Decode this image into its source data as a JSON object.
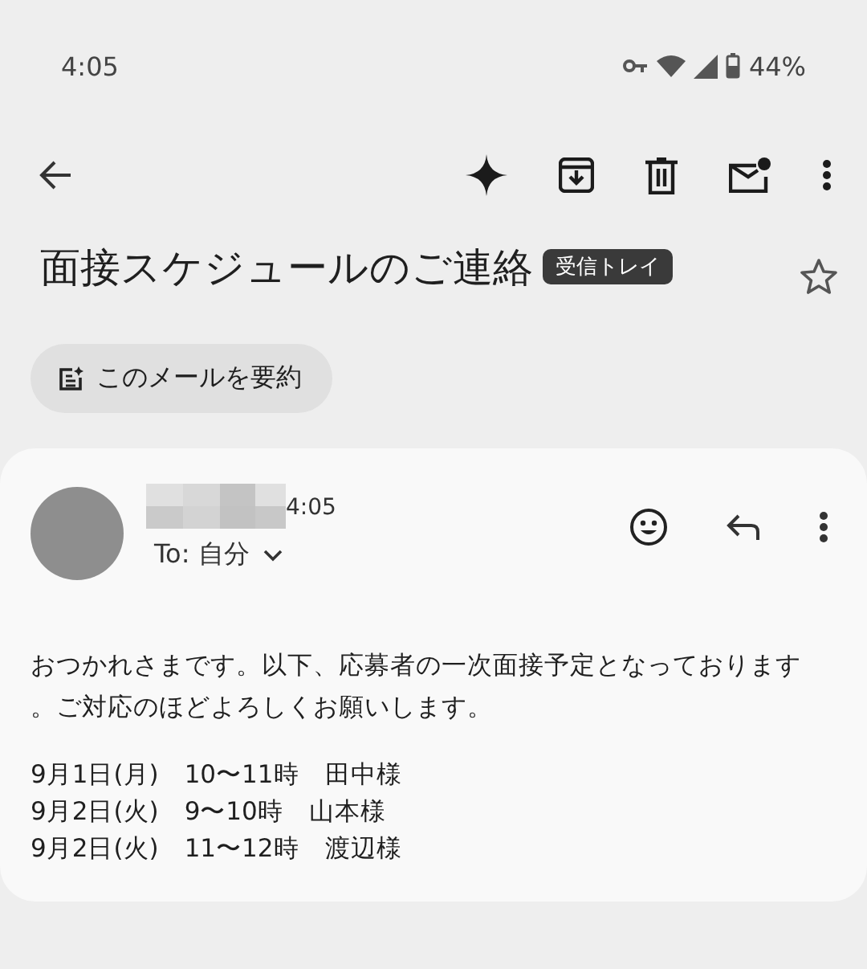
{
  "status_bar": {
    "time": "4:05",
    "battery": "44%"
  },
  "subject": {
    "title": "面接スケジュールのご連絡",
    "label": "受信トレイ",
    "starred": false
  },
  "summary_chip": {
    "label": "このメールを要約"
  },
  "message": {
    "time": "4:05",
    "recipient": "To: 自分",
    "body": [
      "おつかれさまです。以下、応募者の一次面接予定となっております",
      "。ご対応のほどよろしくお願いします。"
    ],
    "schedule": [
      "9月1日(月)　10〜11時　田中様",
      "9月2日(火)　9〜10時　山本様",
      "9月2日(火)　11〜12時　渡辺様"
    ]
  }
}
